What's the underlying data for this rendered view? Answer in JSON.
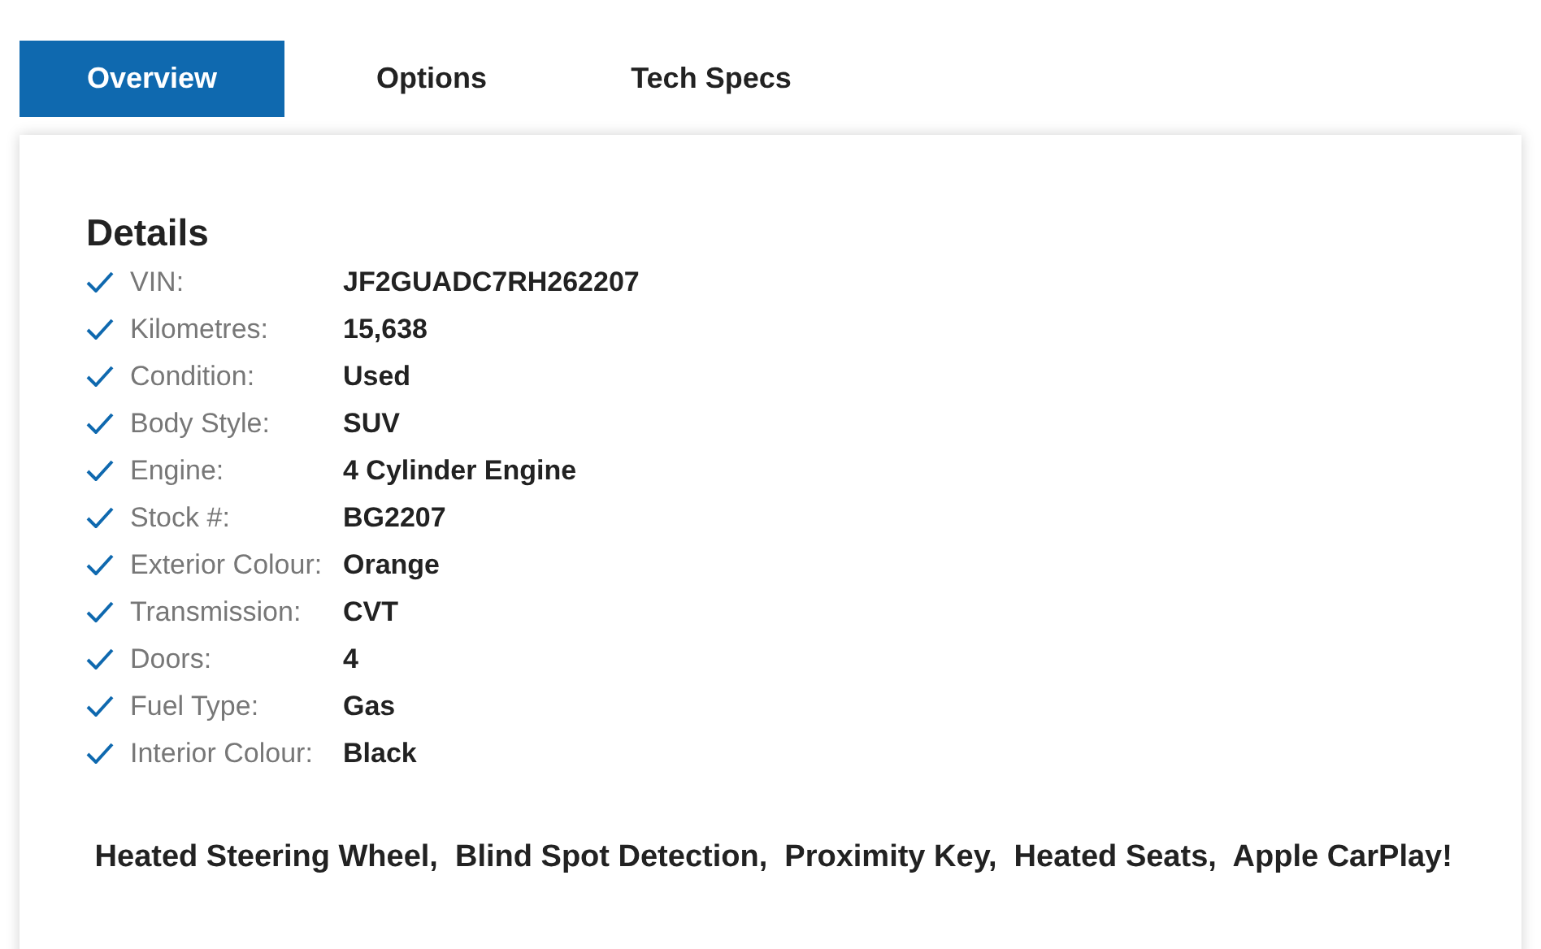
{
  "tabs": [
    {
      "label": "Overview",
      "selected": true
    },
    {
      "label": "Options",
      "selected": false
    },
    {
      "label": "Tech Specs",
      "selected": false
    }
  ],
  "details": {
    "title": "Details",
    "rows": [
      {
        "label": "VIN:",
        "value": "JF2GUADC7RH262207"
      },
      {
        "label": "Kilometres:",
        "value": "15,638"
      },
      {
        "label": "Condition:",
        "value": "Used"
      },
      {
        "label": "Body Style:",
        "value": "SUV"
      },
      {
        "label": "Engine:",
        "value": "4 Cylinder Engine"
      },
      {
        "label": "Stock #:",
        "value": "BG2207"
      },
      {
        "label": "Exterior Colour:",
        "value": "Orange"
      },
      {
        "label": "Transmission:",
        "value": "CVT"
      },
      {
        "label": "Doors:",
        "value": "4"
      },
      {
        "label": "Fuel Type:",
        "value": "Gas"
      },
      {
        "label": "Interior Colour:",
        "value": "Black"
      }
    ]
  },
  "features": " Heated Steering Wheel,  Blind Spot Detection,  Proximity Key,  Heated Seats,  Apple CarPlay!"
}
